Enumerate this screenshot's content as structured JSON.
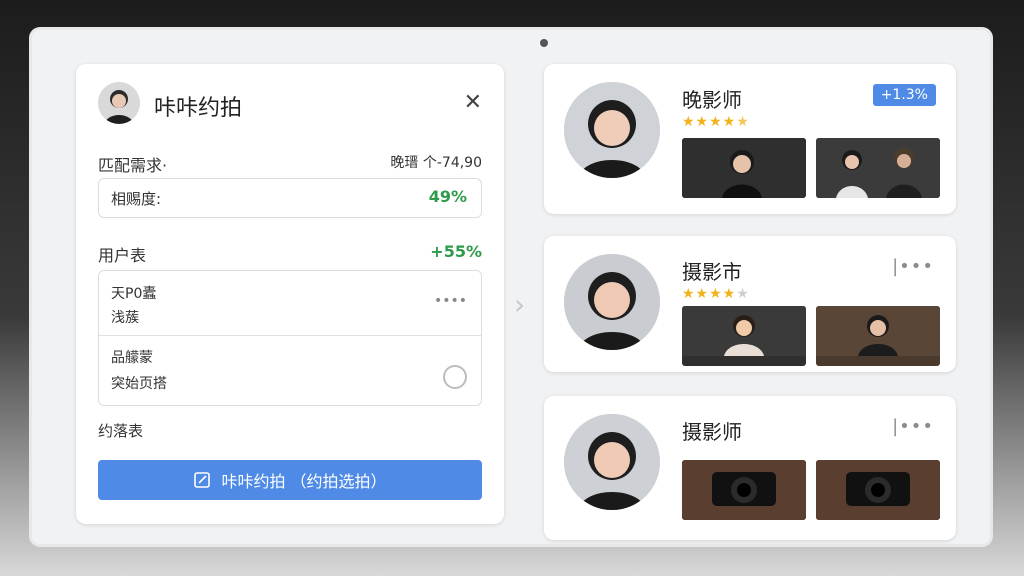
{
  "app": {
    "title": "咔咔约拍",
    "close_icon": "close-icon"
  },
  "panel": {
    "match_label": "匹配需求·",
    "match_value": "晚瑨 个-74,90",
    "similarity_label": "相赐度:",
    "similarity_value": "49%",
    "user_table_label": "用户表",
    "user_table_value": "+55%",
    "row1_line1": "天P0蠹",
    "row1_line2": "浅蔟",
    "row1_more": "••••",
    "row2_line1": "品艨蒙",
    "row2_line2": "突始页搭",
    "appointment_label": "约落表",
    "primary_button_label": "咔咔约拍 （约拍选拍）"
  },
  "cards": [
    {
      "title": "晚影师",
      "stars": 4.5,
      "badge": "+1.3%",
      "more": ""
    },
    {
      "title": "摄影市",
      "stars": 4.5,
      "badge": "",
      "more": "|•••"
    },
    {
      "title": "摄影师",
      "stars": 0,
      "badge": "",
      "more": "|•••"
    }
  ],
  "colors": {
    "accent": "#4f8be6",
    "positive": "#2f9a4a",
    "star": "#f2b21b"
  }
}
